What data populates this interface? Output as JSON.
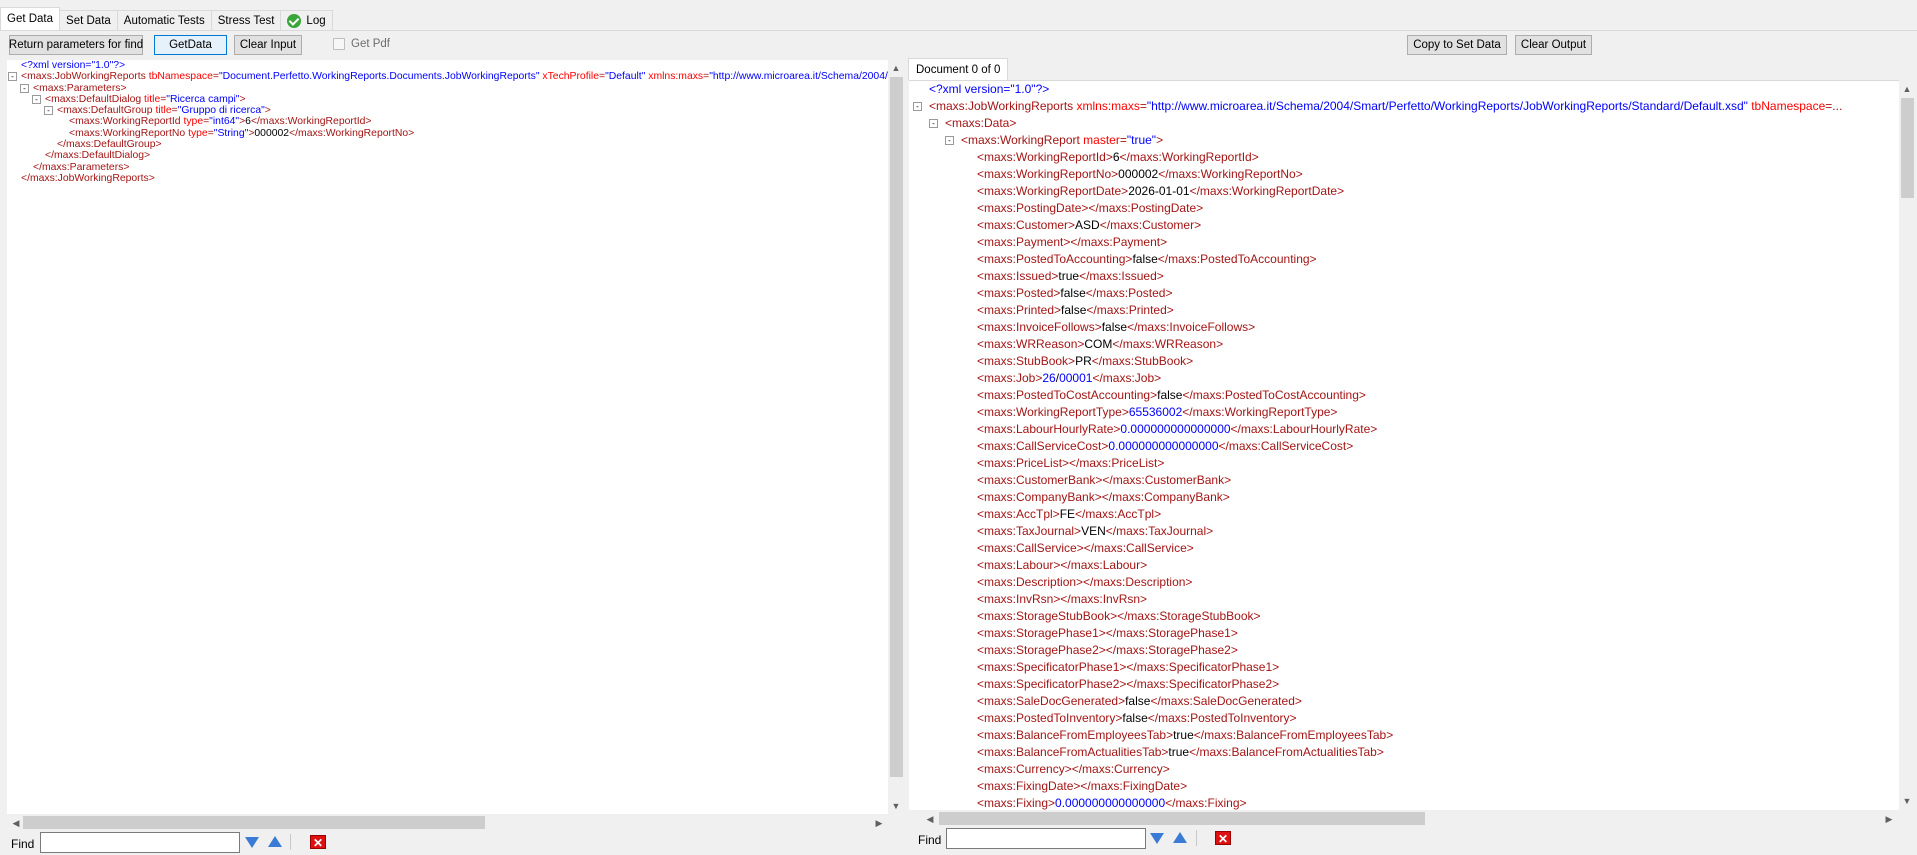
{
  "tabs": [
    {
      "label": "Get Data"
    },
    {
      "label": "Set Data"
    },
    {
      "label": "Automatic Tests"
    },
    {
      "label": "Stress Test"
    },
    {
      "label": "Log"
    }
  ],
  "toolbar": {
    "return_params": "Return parameters for find",
    "getdata": "GetData",
    "clear_input": "Clear Input",
    "get_pdf": "Get Pdf",
    "copy_set": "Copy to Set Data",
    "clear_output": "Clear Output"
  },
  "output": {
    "doc_tab": "Document 0 of 0"
  },
  "find": {
    "label": "Find",
    "value": ""
  },
  "input_xml": [
    {
      "ind": 0,
      "mk": "",
      "parts": [
        [
          "pi",
          "<?xml version=\"1.0\"?>"
        ]
      ]
    },
    {
      "ind": 0,
      "mk": "-",
      "parts": [
        [
          "tg",
          "<maxs:JobWorkingReports "
        ],
        [
          "at",
          "tbNamespace"
        ],
        [
          "tg",
          "="
        ],
        [
          "av",
          "\"Document.Perfetto.WorkingReports.Documents.JobWorkingReports\""
        ],
        [
          "at",
          " xTechProfile"
        ],
        [
          "tg",
          "="
        ],
        [
          "av",
          "\"Default\""
        ],
        [
          "at",
          " xmlns:maxs"
        ],
        [
          "tg",
          "="
        ],
        [
          "av",
          "\"http://www.microarea.it/Schema/2004/Smart/Perfetto/WorkingReports/JobWorkingReports/Standard/Default.xsd\""
        ]
      ]
    },
    {
      "ind": 1,
      "mk": "-",
      "parts": [
        [
          "tg",
          "<maxs:Parameters>"
        ]
      ]
    },
    {
      "ind": 2,
      "mk": "-",
      "parts": [
        [
          "tg",
          "<maxs:DefaultDialog "
        ],
        [
          "at",
          "title"
        ],
        [
          "tg",
          "="
        ],
        [
          "av",
          "\"Ricerca campi\""
        ],
        [
          "tg",
          ">"
        ]
      ]
    },
    {
      "ind": 3,
      "mk": "-",
      "parts": [
        [
          "tg",
          "<maxs:DefaultGroup "
        ],
        [
          "at",
          "title"
        ],
        [
          "tg",
          "="
        ],
        [
          "av",
          "\"Gruppo di ricerca\""
        ],
        [
          "tg",
          ">"
        ]
      ]
    },
    {
      "ind": 4,
      "mk": "",
      "parts": [
        [
          "tg",
          "<maxs:WorkingReportId "
        ],
        [
          "at",
          "type"
        ],
        [
          "tg",
          "="
        ],
        [
          "av",
          "\"int64\""
        ],
        [
          "tg",
          ">"
        ],
        [
          "tx",
          "6"
        ],
        [
          "tg",
          "</maxs:WorkingReportId>"
        ]
      ]
    },
    {
      "ind": 4,
      "mk": "",
      "parts": [
        [
          "tg",
          "<maxs:WorkingReportNo "
        ],
        [
          "at",
          "type"
        ],
        [
          "tg",
          "="
        ],
        [
          "av",
          "\"String\""
        ],
        [
          "tg",
          ">"
        ],
        [
          "tx",
          "000002"
        ],
        [
          "tg",
          "</maxs:WorkingReportNo>"
        ]
      ]
    },
    {
      "ind": 3,
      "mk": "",
      "parts": [
        [
          "tg",
          "</maxs:DefaultGroup>"
        ]
      ]
    },
    {
      "ind": 2,
      "mk": "",
      "parts": [
        [
          "tg",
          "</maxs:DefaultDialog>"
        ]
      ]
    },
    {
      "ind": 1,
      "mk": "",
      "parts": [
        [
          "tg",
          "</maxs:Parameters>"
        ]
      ]
    },
    {
      "ind": 0,
      "mk": "",
      "parts": [
        [
          "tg",
          "</maxs:JobWorkingReports>"
        ]
      ]
    }
  ],
  "output_xml": [
    {
      "ind": 0,
      "mk": "",
      "parts": [
        [
          "pi",
          "<?xml version=\"1.0\"?>"
        ]
      ]
    },
    {
      "ind": 0,
      "mk": "-",
      "parts": [
        [
          "tg",
          "<maxs:JobWorkingReports "
        ],
        [
          "at",
          "xmlns:maxs"
        ],
        [
          "tg",
          "="
        ],
        [
          "av",
          "\"http://www.microarea.it/Schema/2004/Smart/Perfetto/WorkingReports/JobWorkingReports/Standard/Default.xsd\""
        ],
        [
          "at",
          " tbNamespace"
        ],
        [
          "tg",
          "=..."
        ]
      ]
    },
    {
      "ind": 1,
      "mk": "-",
      "parts": [
        [
          "tg",
          "<maxs:Data>"
        ]
      ]
    },
    {
      "ind": 2,
      "mk": "-",
      "parts": [
        [
          "tg",
          "<maxs:WorkingReport "
        ],
        [
          "at",
          "master"
        ],
        [
          "tg",
          "="
        ],
        [
          "av",
          "\"true\""
        ],
        [
          "tg",
          ">"
        ]
      ]
    },
    {
      "ind": 3,
      "mk": "",
      "parts": [
        [
          "tg",
          "<maxs:WorkingReportId>"
        ],
        [
          "tx",
          "6"
        ],
        [
          "tg",
          "</maxs:WorkingReportId>"
        ]
      ]
    },
    {
      "ind": 3,
      "mk": "",
      "parts": [
        [
          "tg",
          "<maxs:WorkingReportNo>"
        ],
        [
          "tx",
          "000002"
        ],
        [
          "tg",
          "</maxs:WorkingReportNo>"
        ]
      ]
    },
    {
      "ind": 3,
      "mk": "",
      "parts": [
        [
          "tg",
          "<maxs:WorkingReportDate>"
        ],
        [
          "tx",
          "2026-01-01"
        ],
        [
          "tg",
          "</maxs:WorkingReportDate>"
        ]
      ]
    },
    {
      "ind": 3,
      "mk": "",
      "parts": [
        [
          "tg",
          "<maxs:PostingDate></maxs:PostingDate>"
        ]
      ]
    },
    {
      "ind": 3,
      "mk": "",
      "parts": [
        [
          "tg",
          "<maxs:Customer>"
        ],
        [
          "tx",
          "ASD"
        ],
        [
          "tg",
          "</maxs:Customer>"
        ]
      ]
    },
    {
      "ind": 3,
      "mk": "",
      "parts": [
        [
          "tg",
          "<maxs:Payment></maxs:Payment>"
        ]
      ]
    },
    {
      "ind": 3,
      "mk": "",
      "parts": [
        [
          "tg",
          "<maxs:PostedToAccounting>"
        ],
        [
          "tx",
          "false"
        ],
        [
          "tg",
          "</maxs:PostedToAccounting>"
        ]
      ]
    },
    {
      "ind": 3,
      "mk": "",
      "parts": [
        [
          "tg",
          "<maxs:Issued>"
        ],
        [
          "tx",
          "true"
        ],
        [
          "tg",
          "</maxs:Issued>"
        ]
      ]
    },
    {
      "ind": 3,
      "mk": "",
      "parts": [
        [
          "tg",
          "<maxs:Posted>"
        ],
        [
          "tx",
          "false"
        ],
        [
          "tg",
          "</maxs:Posted>"
        ]
      ]
    },
    {
      "ind": 3,
      "mk": "",
      "parts": [
        [
          "tg",
          "<maxs:Printed>"
        ],
        [
          "tx",
          "false"
        ],
        [
          "tg",
          "</maxs:Printed>"
        ]
      ]
    },
    {
      "ind": 3,
      "mk": "",
      "parts": [
        [
          "tg",
          "<maxs:InvoiceFollows>"
        ],
        [
          "tx",
          "false"
        ],
        [
          "tg",
          "</maxs:InvoiceFollows>"
        ]
      ]
    },
    {
      "ind": 3,
      "mk": "",
      "parts": [
        [
          "tg",
          "<maxs:WRReason>"
        ],
        [
          "tx",
          "COM"
        ],
        [
          "tg",
          "</maxs:WRReason>"
        ]
      ]
    },
    {
      "ind": 3,
      "mk": "",
      "parts": [
        [
          "tg",
          "<maxs:StubBook>"
        ],
        [
          "tx",
          "PR"
        ],
        [
          "tg",
          "</maxs:StubBook>"
        ]
      ]
    },
    {
      "ind": 3,
      "mk": "",
      "parts": [
        [
          "tg",
          "<maxs:Job>"
        ],
        [
          "av",
          "26"
        ],
        [
          "tx",
          "/"
        ],
        [
          "av",
          "00001"
        ],
        [
          "tg",
          "</maxs:Job>"
        ]
      ]
    },
    {
      "ind": 3,
      "mk": "",
      "parts": [
        [
          "tg",
          "<maxs:PostedToCostAccounting>"
        ],
        [
          "tx",
          "false"
        ],
        [
          "tg",
          "</maxs:PostedToCostAccounting>"
        ]
      ]
    },
    {
      "ind": 3,
      "mk": "",
      "parts": [
        [
          "tg",
          "<maxs:WorkingReportType>"
        ],
        [
          "av",
          "65536002"
        ],
        [
          "tg",
          "</maxs:WorkingReportType>"
        ]
      ]
    },
    {
      "ind": 3,
      "mk": "",
      "parts": [
        [
          "tg",
          "<maxs:LabourHourlyRate>"
        ],
        [
          "av",
          "0.000000000000000"
        ],
        [
          "tg",
          "</maxs:LabourHourlyRate>"
        ]
      ]
    },
    {
      "ind": 3,
      "mk": "",
      "parts": [
        [
          "tg",
          "<maxs:CallServiceCost>"
        ],
        [
          "av",
          "0.000000000000000"
        ],
        [
          "tg",
          "</maxs:CallServiceCost>"
        ]
      ]
    },
    {
      "ind": 3,
      "mk": "",
      "parts": [
        [
          "tg",
          "<maxs:PriceList></maxs:PriceList>"
        ]
      ]
    },
    {
      "ind": 3,
      "mk": "",
      "parts": [
        [
          "tg",
          "<maxs:CustomerBank></maxs:CustomerBank>"
        ]
      ]
    },
    {
      "ind": 3,
      "mk": "",
      "parts": [
        [
          "tg",
          "<maxs:CompanyBank></maxs:CompanyBank>"
        ]
      ]
    },
    {
      "ind": 3,
      "mk": "",
      "parts": [
        [
          "tg",
          "<maxs:AccTpl>"
        ],
        [
          "tx",
          "FE"
        ],
        [
          "tg",
          "</maxs:AccTpl>"
        ]
      ]
    },
    {
      "ind": 3,
      "mk": "",
      "parts": [
        [
          "tg",
          "<maxs:TaxJournal>"
        ],
        [
          "tx",
          "VEN"
        ],
        [
          "tg",
          "</maxs:TaxJournal>"
        ]
      ]
    },
    {
      "ind": 3,
      "mk": "",
      "parts": [
        [
          "tg",
          "<maxs:CallService></maxs:CallService>"
        ]
      ]
    },
    {
      "ind": 3,
      "mk": "",
      "parts": [
        [
          "tg",
          "<maxs:Labour></maxs:Labour>"
        ]
      ]
    },
    {
      "ind": 3,
      "mk": "",
      "parts": [
        [
          "tg",
          "<maxs:Description></maxs:Description>"
        ]
      ]
    },
    {
      "ind": 3,
      "mk": "",
      "parts": [
        [
          "tg",
          "<maxs:InvRsn></maxs:InvRsn>"
        ]
      ]
    },
    {
      "ind": 3,
      "mk": "",
      "parts": [
        [
          "tg",
          "<maxs:StorageStubBook></maxs:StorageStubBook>"
        ]
      ]
    },
    {
      "ind": 3,
      "mk": "",
      "parts": [
        [
          "tg",
          "<maxs:StoragePhase1></maxs:StoragePhase1>"
        ]
      ]
    },
    {
      "ind": 3,
      "mk": "",
      "parts": [
        [
          "tg",
          "<maxs:StoragePhase2></maxs:StoragePhase2>"
        ]
      ]
    },
    {
      "ind": 3,
      "mk": "",
      "parts": [
        [
          "tg",
          "<maxs:SpecificatorPhase1></maxs:SpecificatorPhase1>"
        ]
      ]
    },
    {
      "ind": 3,
      "mk": "",
      "parts": [
        [
          "tg",
          "<maxs:SpecificatorPhase2></maxs:SpecificatorPhase2>"
        ]
      ]
    },
    {
      "ind": 3,
      "mk": "",
      "parts": [
        [
          "tg",
          "<maxs:SaleDocGenerated>"
        ],
        [
          "tx",
          "false"
        ],
        [
          "tg",
          "</maxs:SaleDocGenerated>"
        ]
      ]
    },
    {
      "ind": 3,
      "mk": "",
      "parts": [
        [
          "tg",
          "<maxs:PostedToInventory>"
        ],
        [
          "tx",
          "false"
        ],
        [
          "tg",
          "</maxs:PostedToInventory>"
        ]
      ]
    },
    {
      "ind": 3,
      "mk": "",
      "parts": [
        [
          "tg",
          "<maxs:BalanceFromEmployeesTab>"
        ],
        [
          "tx",
          "true"
        ],
        [
          "tg",
          "</maxs:BalanceFromEmployeesTab>"
        ]
      ]
    },
    {
      "ind": 3,
      "mk": "",
      "parts": [
        [
          "tg",
          "<maxs:BalanceFromActualitiesTab>"
        ],
        [
          "tx",
          "true"
        ],
        [
          "tg",
          "</maxs:BalanceFromActualitiesTab>"
        ]
      ]
    },
    {
      "ind": 3,
      "mk": "",
      "parts": [
        [
          "tg",
          "<maxs:Currency></maxs:Currency>"
        ]
      ]
    },
    {
      "ind": 3,
      "mk": "",
      "parts": [
        [
          "tg",
          "<maxs:FixingDate></maxs:FixingDate>"
        ]
      ]
    },
    {
      "ind": 3,
      "mk": "",
      "parts": [
        [
          "tg",
          "<maxs:Fixing>"
        ],
        [
          "av",
          "0.000000000000000"
        ],
        [
          "tg",
          "</maxs:Fixing>"
        ]
      ]
    }
  ]
}
